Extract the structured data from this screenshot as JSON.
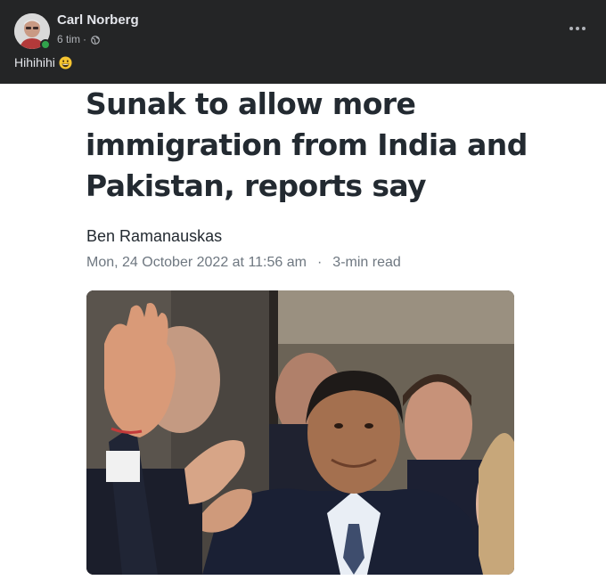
{
  "post": {
    "author": "Carl Norberg",
    "time": "6 tim",
    "separator": "·",
    "text": "Hihihihi",
    "icons": {
      "globe": "globe-icon",
      "emoji": "grinning-face-emoji",
      "more": "more-options-icon"
    },
    "colors": {
      "header_bg": "#242526",
      "online": "#31a24c"
    }
  },
  "article": {
    "headline": "Sunak to allow more immigration from India and Pakistan, reports say",
    "author": "Ben Ramanauskas",
    "date": "Mon, 24 October 2022 at 11:56 am",
    "separator": "·",
    "read_time": "3-min read",
    "photo_alt": "man in suit smiling and waving"
  }
}
